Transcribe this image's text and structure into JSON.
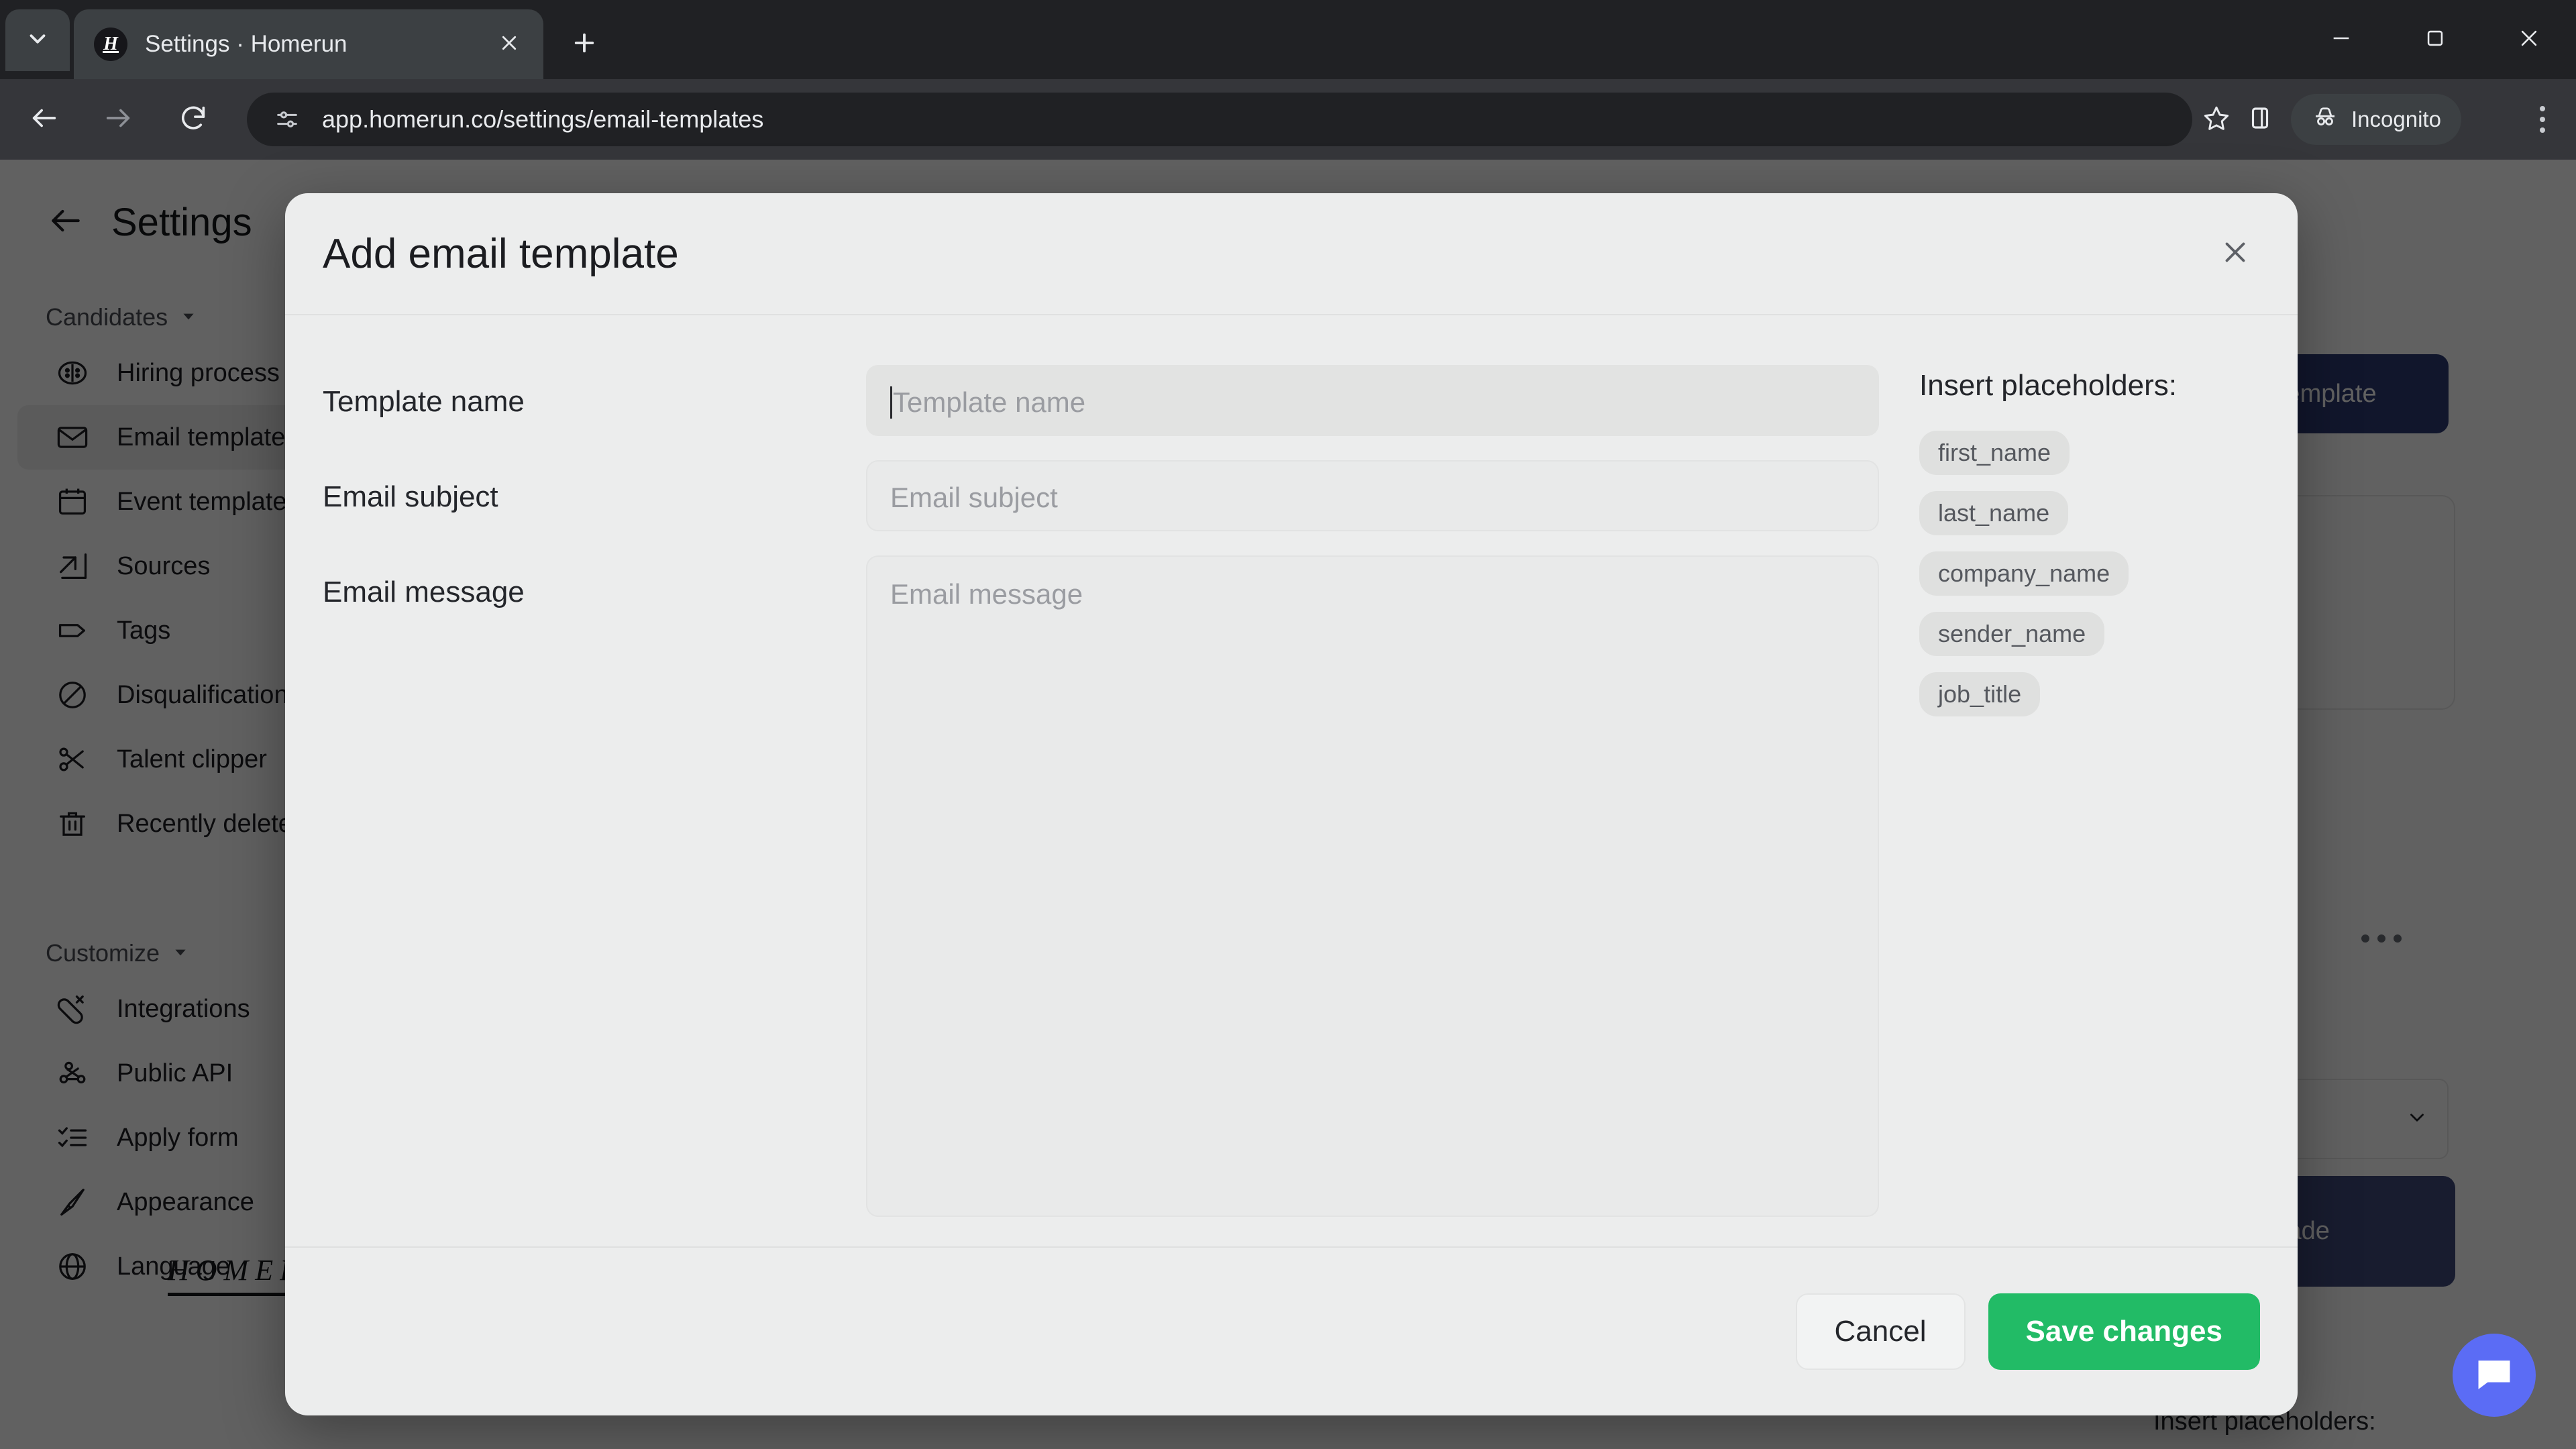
{
  "browser": {
    "tab": {
      "title": "Settings · Homerun",
      "favicon_letter": "H"
    },
    "url": "app.homerun.co/settings/email-templates",
    "profile_label": "Incognito",
    "icons": {
      "tab_search": "chevron-down-icon",
      "tab_close": "close-icon",
      "new_tab": "plus-icon",
      "back": "back-arrow-icon",
      "forward": "forward-arrow-icon",
      "reload": "reload-icon",
      "site_info": "site-settings-icon",
      "bookmark": "star-icon",
      "side_panel": "side-panel-icon",
      "incognito": "incognito-hat-icon",
      "menu": "three-dots-menu-icon",
      "minimize": "minimize-icon",
      "maximize": "maximize-icon",
      "close_window": "window-close-icon"
    }
  },
  "page": {
    "header": {
      "back_icon": "back-arrow-icon",
      "title": "Settings"
    },
    "sidebar": {
      "groups": [
        {
          "label": "Candidates",
          "caret_icon": "chevron-down-icon",
          "items": [
            {
              "label": "Hiring process",
              "icon": "hiring-process-icon",
              "active": false
            },
            {
              "label": "Email templates",
              "icon": "envelope-icon",
              "active": true
            },
            {
              "label": "Event templates",
              "icon": "calendar-icon",
              "active": false
            },
            {
              "label": "Sources",
              "icon": "external-link-icon",
              "active": false
            },
            {
              "label": "Tags",
              "icon": "tag-icon",
              "active": false
            },
            {
              "label": "Disqualification",
              "icon": "no-entry-icon",
              "active": false
            },
            {
              "label": "Talent clipper",
              "icon": "scissors-icon",
              "active": false
            },
            {
              "label": "Recently deleted",
              "icon": "trash-icon",
              "active": false
            }
          ]
        },
        {
          "label": "Customize",
          "caret_icon": "chevron-down-icon",
          "items": [
            {
              "label": "Integrations",
              "icon": "plug-icon",
              "active": false
            },
            {
              "label": "Public API",
              "icon": "api-nodes-icon",
              "active": false
            },
            {
              "label": "Apply form",
              "icon": "checklist-icon",
              "active": false
            },
            {
              "label": "Appearance",
              "icon": "paintbrush-icon",
              "active": false
            },
            {
              "label": "Language",
              "icon": "globe-icon",
              "active": false
            }
          ]
        }
      ],
      "brand": "HOMERUN"
    },
    "background": {
      "add_template_button": "Add email template",
      "upgrade_button": "Upgrade",
      "row_menu_icon": "three-dots-horizontal-icon",
      "select_caret_icon": "chevron-down-icon",
      "insert_placeholders_label": "Insert placeholders:",
      "intercom_icon": "chat-bubble-icon"
    }
  },
  "modal": {
    "title": "Add email template",
    "close_icon": "close-icon",
    "fields": [
      {
        "label": "Template name",
        "placeholder": "Template name",
        "value": "",
        "type": "text",
        "focused": true
      },
      {
        "label": "Email subject",
        "placeholder": "Email subject",
        "value": "",
        "type": "text",
        "focused": false
      },
      {
        "label": "Email message",
        "placeholder": "Email message",
        "value": "",
        "type": "textarea",
        "focused": false
      }
    ],
    "placeholders": {
      "title": "Insert placeholders:",
      "chips": [
        "first_name",
        "last_name",
        "company_name",
        "sender_name",
        "job_title"
      ]
    },
    "footer": {
      "cancel_label": "Cancel",
      "save_label": "Save changes"
    }
  },
  "colors": {
    "accent_green": "#22bb66",
    "brand_navy": "#2f3b73",
    "intercom_blue": "#5b6cf5",
    "chrome_bg": "#202124",
    "modal_bg": "#eceded"
  }
}
